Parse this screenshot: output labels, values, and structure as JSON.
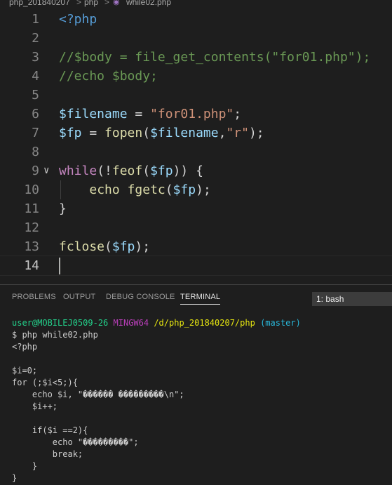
{
  "breadcrumb": {
    "folder": "php_201840207",
    "subfolder": "php",
    "file": "while02.php",
    "separator": ">",
    "file_icon": "php-elephant-icon"
  },
  "editor": {
    "current_line": 14,
    "lines": [
      {
        "n": "1",
        "code": "<?php"
      },
      {
        "n": "2",
        "code": ""
      },
      {
        "n": "3",
        "code": "//$body = file_get_contents(\"for01.php\");"
      },
      {
        "n": "4",
        "code": "//echo $body;"
      },
      {
        "n": "5",
        "code": ""
      },
      {
        "n": "6",
        "code": "$filename = \"for01.php\";"
      },
      {
        "n": "7",
        "code": "$fp = fopen($filename,\"r\");"
      },
      {
        "n": "8",
        "code": ""
      },
      {
        "n": "9",
        "code": "while(!feof($fp)) {"
      },
      {
        "n": "10",
        "code": "    echo fgetc($fp);"
      },
      {
        "n": "11",
        "code": "}"
      },
      {
        "n": "12",
        "code": ""
      },
      {
        "n": "13",
        "code": "fclose($fp);"
      },
      {
        "n": "14",
        "code": ""
      }
    ]
  },
  "panel": {
    "tabs": [
      "PROBLEMS",
      "OUTPUT",
      "DEBUG CONSOLE",
      "TERMINAL"
    ],
    "active_tab": "TERMINAL",
    "terminal_select": "1: bash",
    "prompt": {
      "user": "user@MOBILEJ0509-26",
      "env": "MINGW64",
      "path": "/d/php_201840207/php",
      "branch": "(master)"
    },
    "command": "$ php while02.php",
    "output": [
      "<?php",
      "",
      "$i=0;",
      "for (;$i<5;){",
      "    echo $i, \"������ ���������\\n\";",
      "    $i++;",
      "",
      "    if($i ==2){",
      "        echo \"���������\";",
      "        break;",
      "    }",
      "}"
    ]
  },
  "colors": {
    "background": "#1e1e1e",
    "keyword": "#c586c0",
    "variable": "#9cdcfe",
    "string": "#ce9178",
    "comment": "#6a9955",
    "function": "#dcdcaa",
    "terminal_green": "#23d18b",
    "terminal_yellow": "#e5e510"
  }
}
